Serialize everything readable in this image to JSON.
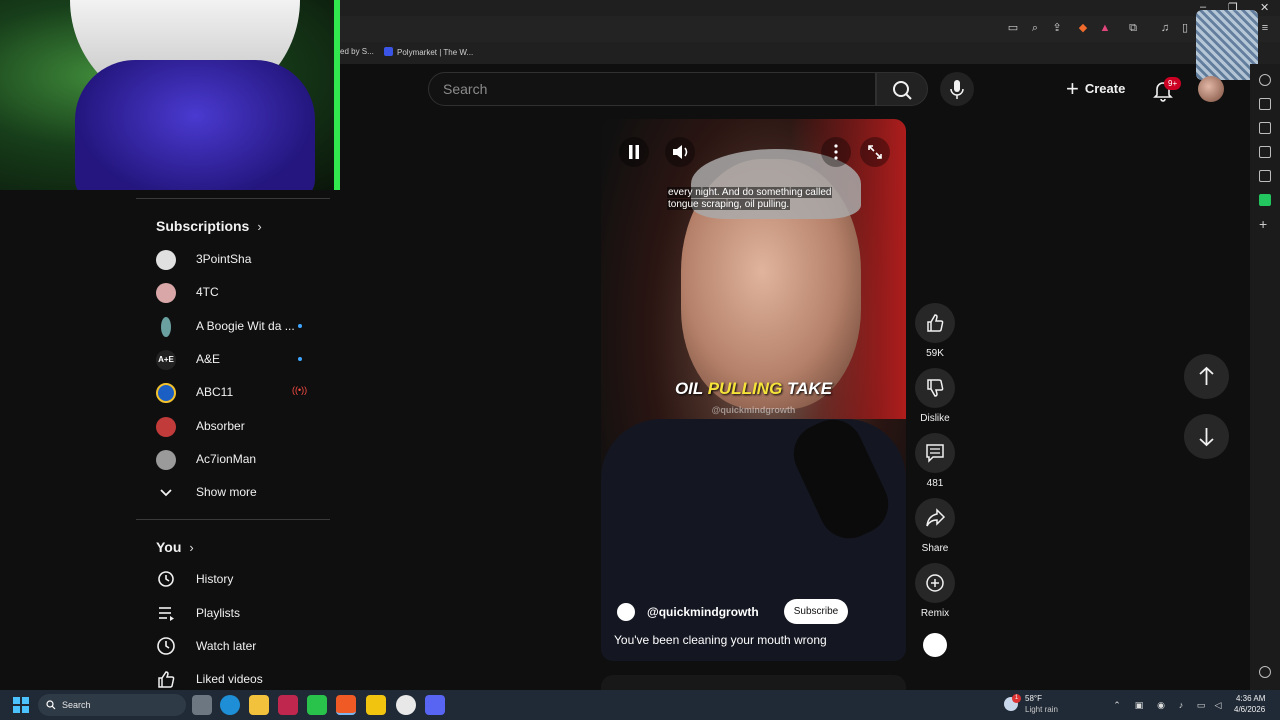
{
  "browser": {
    "bookmarks": [
      {
        "label": "ed by S..."
      },
      {
        "label": "Polymarket | The W..."
      }
    ],
    "window_controls": [
      "–",
      "❐",
      "✕"
    ]
  },
  "header": {
    "search_placeholder": "Search",
    "create_label": "Create",
    "notification_count": "9+"
  },
  "subscriptions": {
    "heading": "Subscriptions",
    "items": [
      {
        "name": "3PointSha",
        "indicator": "",
        "color": "#e0e0e0"
      },
      {
        "name": "4TC",
        "indicator": "",
        "color": "#d9a7a7"
      },
      {
        "name": "A Boogie Wit da ...",
        "indicator": "dot",
        "color": "#6aa0a0"
      },
      {
        "name": "A&E",
        "indicator": "dot",
        "color": "#222222"
      },
      {
        "name": "ABC11",
        "indicator": "live",
        "color": "#1c5fc4"
      },
      {
        "name": "Absorber",
        "indicator": "",
        "color": "#c23b3b"
      },
      {
        "name": "Ac7ionMan",
        "indicator": "",
        "color": "#9a9a9a"
      }
    ],
    "show_more_label": "Show more"
  },
  "you_section": {
    "heading": "You",
    "items": [
      {
        "label": "History",
        "icon": "history-icon"
      },
      {
        "label": "Playlists",
        "icon": "playlists-icon"
      },
      {
        "label": "Watch later",
        "icon": "clock-icon"
      },
      {
        "label": "Liked videos",
        "icon": "thumb-up-icon"
      }
    ]
  },
  "short": {
    "caption_top_line1": "every night. And do something called",
    "caption_top_line2": "tongue scraping, oil pulling.",
    "caption_main_pre": "OIL ",
    "caption_main_highlight": "PULLING",
    "caption_main_post": " TAKE",
    "watermark": "@quickmindgrowth",
    "channel": "@quickmindgrowth",
    "subscribe_label": "Subscribe",
    "title": "You've been cleaning your mouth wrong"
  },
  "actions": {
    "likes": "59K",
    "dislike_label": "Dislike",
    "comments": "481",
    "share_label": "Share",
    "remix_label": "Remix"
  },
  "taskbar": {
    "search_label": "Search",
    "weather_temp": "58°F",
    "weather_desc": "Light rain",
    "weather_badge": "1",
    "time": "4:36 AM",
    "date": "4/6/2026"
  },
  "colors": {
    "accent_red": "#cc0022",
    "link_blue": "#3ea6ff",
    "caption_highlight": "#f5e33a"
  }
}
